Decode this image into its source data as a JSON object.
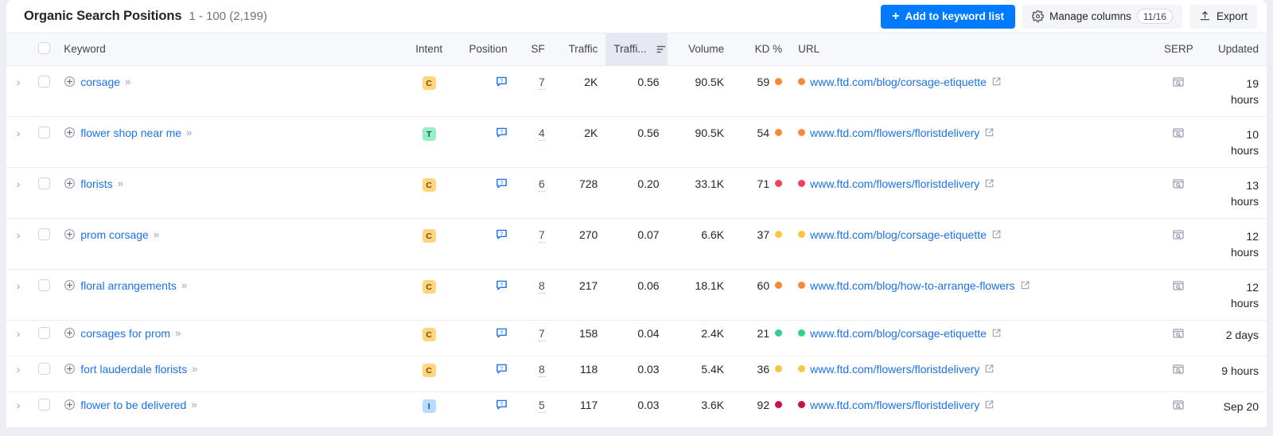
{
  "header": {
    "title": "Organic Search Positions",
    "range": "1 - 100 (2,199)",
    "add_to_list_label": "Add to keyword list",
    "manage_columns_label": "Manage columns",
    "manage_columns_count": "11/16",
    "export_label": "Export",
    "plus_glyph": "+"
  },
  "colors": {
    "primary_button": "#007bff",
    "link": "#1a73e8",
    "sorted_header_bg": "#e6e9f1",
    "kd_green": "#2fd38a",
    "kd_yellow": "#fdc43f",
    "kd_orange": "#fb8836",
    "kd_red": "#f43f5e",
    "kd_darkred": "#d10f3e",
    "intent_c": "#ffd57e",
    "intent_t": "#96efc4",
    "intent_i": "#b7dcff"
  },
  "table": {
    "columns": [
      {
        "key": "keyword",
        "label": "Keyword",
        "align": "left"
      },
      {
        "key": "intent",
        "label": "Intent",
        "align": "center"
      },
      {
        "key": "position",
        "label": "Position",
        "align": "right"
      },
      {
        "key": "sf",
        "label": "SF",
        "align": "right"
      },
      {
        "key": "traffic",
        "label": "Traffic",
        "align": "right"
      },
      {
        "key": "traffic_pct",
        "label": "Traffi...",
        "align": "right",
        "sorted": true
      },
      {
        "key": "volume",
        "label": "Volume",
        "align": "right"
      },
      {
        "key": "kd",
        "label": "KD %",
        "align": "right"
      },
      {
        "key": "url",
        "label": "URL",
        "align": "left"
      },
      {
        "key": "serp",
        "label": "SERP",
        "align": "center"
      },
      {
        "key": "updated",
        "label": "Updated",
        "align": "right"
      }
    ],
    "rows": [
      {
        "keyword": "corsage",
        "intent": "C",
        "position": "7",
        "traffic": "2K",
        "traffic_pct": "0.56",
        "volume": "90.5K",
        "kd": "59",
        "kd_color": "#fb8836",
        "url": "www.ftd.com/blog/corsage-etiquette",
        "url_dot_color": "#fb8836",
        "updated": "19 hours",
        "tall": true
      },
      {
        "keyword": "flower shop near me",
        "intent": "T",
        "position": "4",
        "traffic": "2K",
        "traffic_pct": "0.56",
        "volume": "90.5K",
        "kd": "54",
        "kd_color": "#fb8836",
        "url": "www.ftd.com/flowers/floristdelivery",
        "url_dot_color": "#fb8836",
        "updated": "10 hours",
        "tall": true
      },
      {
        "keyword": "florists",
        "intent": "C",
        "position": "6",
        "traffic": "728",
        "traffic_pct": "0.20",
        "volume": "33.1K",
        "kd": "71",
        "kd_color": "#f43f5e",
        "url": "www.ftd.com/flowers/floristdelivery",
        "url_dot_color": "#f43f5e",
        "updated": "13 hours",
        "tall": true
      },
      {
        "keyword": "prom corsage",
        "intent": "C",
        "position": "7",
        "traffic": "270",
        "traffic_pct": "0.07",
        "volume": "6.6K",
        "kd": "37",
        "kd_color": "#fdc43f",
        "url": "www.ftd.com/blog/corsage-etiquette",
        "url_dot_color": "#fdc43f",
        "updated": "12 hours",
        "tall": true
      },
      {
        "keyword": "floral arrangements",
        "intent": "C",
        "position": "8",
        "traffic": "217",
        "traffic_pct": "0.06",
        "volume": "18.1K",
        "kd": "60",
        "kd_color": "#fb8836",
        "url": "www.ftd.com/blog/how-to-arrange-flowers",
        "url_dot_color": "#fb8836",
        "updated": "12 hours",
        "tall": true
      },
      {
        "keyword": "corsages for prom",
        "intent": "C",
        "position": "7",
        "traffic": "158",
        "traffic_pct": "0.04",
        "volume": "2.4K",
        "kd": "21",
        "kd_color": "#2fd38a",
        "url": "www.ftd.com/blog/corsage-etiquette",
        "url_dot_color": "#2fd38a",
        "updated": "2 days",
        "tall": false
      },
      {
        "keyword": "fort lauderdale florists",
        "intent": "C",
        "position": "8",
        "traffic": "118",
        "traffic_pct": "0.03",
        "volume": "5.4K",
        "kd": "36",
        "kd_color": "#fdc43f",
        "url": "www.ftd.com/flowers/floristdelivery",
        "url_dot_color": "#fdc43f",
        "updated": "9 hours",
        "tall": false
      },
      {
        "keyword": "flower to be delivered",
        "intent": "I",
        "position": "5",
        "traffic": "117",
        "traffic_pct": "0.03",
        "volume": "3.6K",
        "kd": "92",
        "kd_color": "#d10f3e",
        "url": "www.ftd.com/flowers/floristdelivery",
        "url_dot_color": "#d10f3e",
        "updated": "Sep 20",
        "tall": false
      }
    ]
  },
  "icons": {
    "expand_row": "›",
    "add_keyword": "⊕",
    "keyword_more": "»",
    "sf_feature": "sf-question-icon",
    "external_link": "external-link-icon",
    "serp_preview": "serp-preview-icon",
    "sort": "sort-icon",
    "gear": "gear-icon",
    "export": "upload-icon"
  }
}
